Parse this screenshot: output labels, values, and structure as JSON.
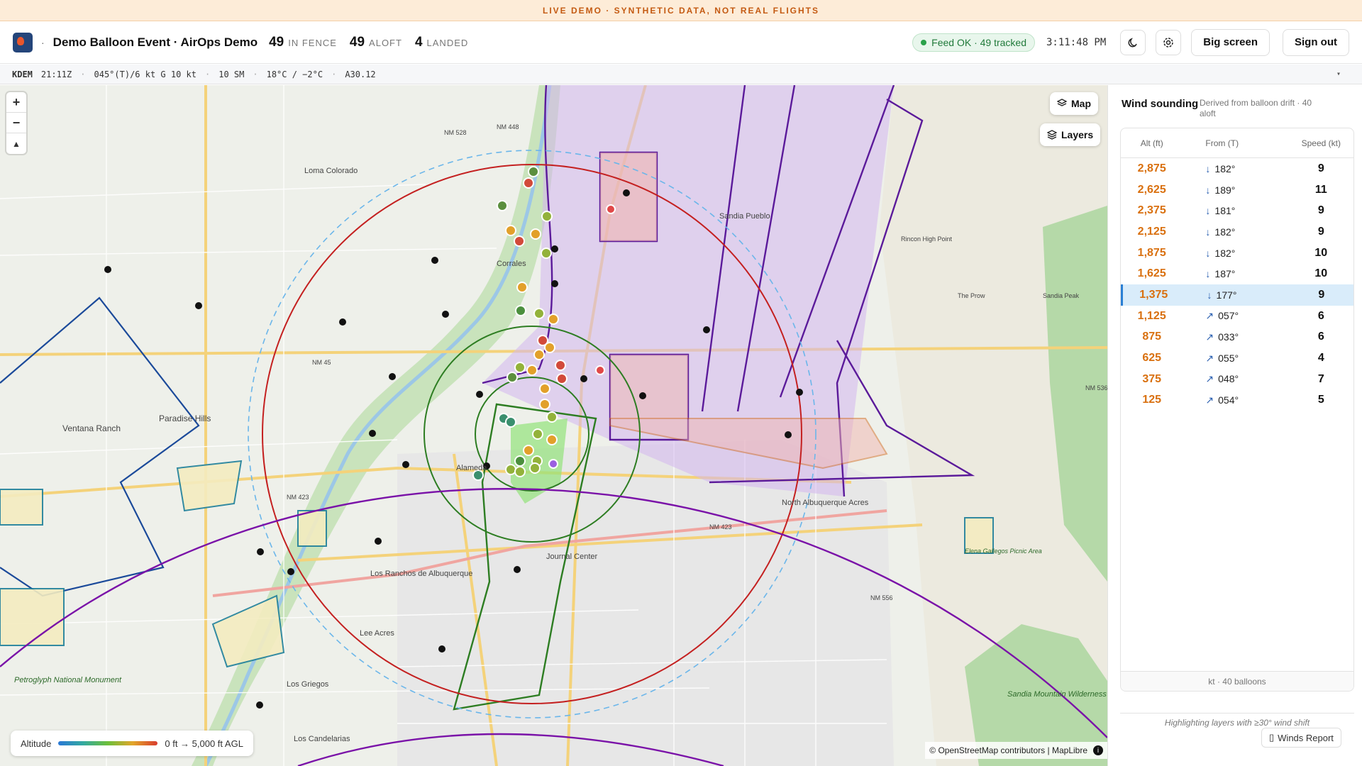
{
  "banner": {
    "text": "LIVE DEMO · SYNTHETIC DATA, NOT REAL FLIGHTS"
  },
  "header": {
    "separator": "·",
    "title": "Demo Balloon Event · AirOps Demo",
    "stats": [
      {
        "value": "49",
        "label": "IN FENCE"
      },
      {
        "value": "49",
        "label": "ALOFT"
      },
      {
        "value": "4",
        "label": "LANDED"
      }
    ],
    "feed_status": "Feed OK · 49 tracked",
    "clock": "3:11:48 PM",
    "big_screen_label": "Big screen",
    "sign_out_label": "Sign out",
    "theme_icon": "moon-icon",
    "settings_icon": "gear-icon"
  },
  "metar": {
    "station": "KDEM",
    "time": "21:11Z",
    "wind": "045°(T)/6 kt G 10 kt",
    "visibility": "10 SM",
    "temp_dew": "18°C / −2°C",
    "altimeter": "A30.12",
    "sep": "·",
    "caret": "▾"
  },
  "map": {
    "zoom_in": "+",
    "zoom_out": "−",
    "compass": "▲",
    "map_button": "Map",
    "layers_button": "Layers",
    "legend_label": "Altitude",
    "legend_range": "0 ft → 5,000 ft AGL",
    "attribution": "© OpenStreetMap contributors | MapLibre",
    "info": "i",
    "labels": {
      "corrales": "Corrales",
      "paradise_hills": "Paradise Hills",
      "ventana_ranch": "Ventana Ranch",
      "alameda": "Alameda",
      "north_albuquerque_acres": "North Albuquerque Acres",
      "los_ranchos": "Los Ranchos de Albuquerque",
      "lee_acres": "Lee Acres",
      "los_griegos": "Los Griegos",
      "los_candelarias": "Los Candelarias",
      "loma_colorado": "Loma Colorado",
      "sandia_pueblo": "Sandia Pueblo",
      "petroglyph_monument": "Petroglyph National Monument",
      "journal_center": "Journal Center",
      "sandia_mountain": "Sandia Mountain Wilderness",
      "nm528": "NM 528",
      "nm423": "NM 423",
      "nm556": "NM 556",
      "nm45": "NM 45",
      "nm536": "NM 536",
      "nm448": "NM 448",
      "elena_gallegos": "Elena Gallegos Picnic Area",
      "sandia_peak": "Sandia Peak",
      "the_prow": "The Prow",
      "rincon": "Rincon High Point"
    }
  },
  "wind_panel": {
    "title": "Wind sounding",
    "subtitle": "Derived from balloon drift · 40 aloft",
    "headers": {
      "alt": "Alt (ft)",
      "from": "From (T)",
      "speed": "Speed (kt)"
    },
    "rows": [
      {
        "alt": "2,875",
        "arrow": "↓",
        "dir": "182°",
        "speed": "9"
      },
      {
        "alt": "2,625",
        "arrow": "↓",
        "dir": "189°",
        "speed": "11"
      },
      {
        "alt": "2,375",
        "arrow": "↓",
        "dir": "181°",
        "speed": "9"
      },
      {
        "alt": "2,125",
        "arrow": "↓",
        "dir": "182°",
        "speed": "9"
      },
      {
        "alt": "1,875",
        "arrow": "↓",
        "dir": "182°",
        "speed": "10"
      },
      {
        "alt": "1,625",
        "arrow": "↓",
        "dir": "187°",
        "speed": "10"
      },
      {
        "alt": "1,375",
        "arrow": "↓",
        "dir": "177°",
        "speed": "9",
        "highlight": true
      },
      {
        "alt": "1,125",
        "arrow": "↗",
        "dir": "057°",
        "speed": "6"
      },
      {
        "alt": "875",
        "arrow": "↗",
        "dir": "033°",
        "speed": "6"
      },
      {
        "alt": "625",
        "arrow": "↗",
        "dir": "055°",
        "speed": "4"
      },
      {
        "alt": "375",
        "arrow": "↗",
        "dir": "048°",
        "speed": "7"
      },
      {
        "alt": "125",
        "arrow": "↗",
        "dir": "054°",
        "speed": "5"
      }
    ],
    "footer": "kt · 40 balloons",
    "hint": "Highlighting layers with ≥30° wind shift",
    "winds_report_label": "Winds Report"
  }
}
